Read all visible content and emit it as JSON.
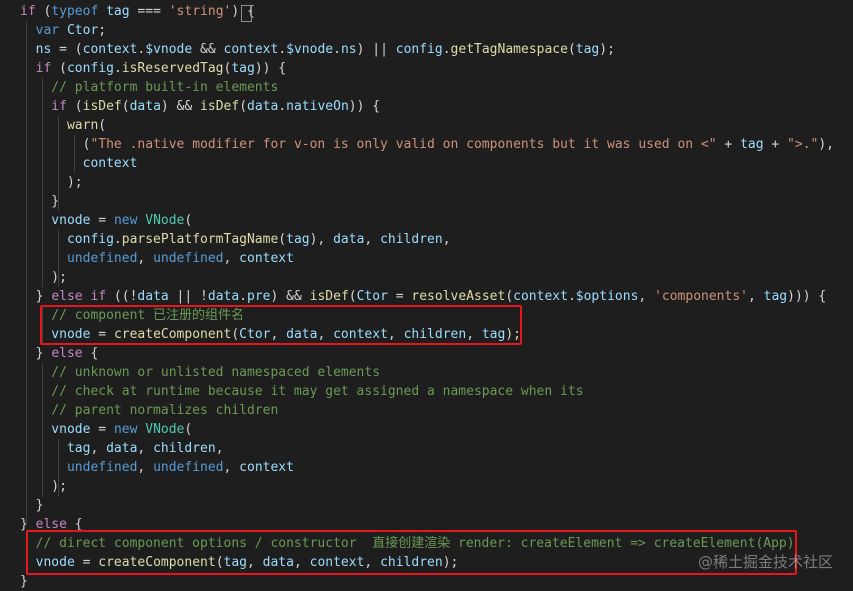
{
  "editor": {
    "theme": "dark",
    "background": "#1e1e1e",
    "colors": {
      "keyword": "#c586c0",
      "storage": "#569cd6",
      "function": "#dcdcaa",
      "variable": "#9cdcfe",
      "string": "#ce9178",
      "comment": "#6a9955",
      "plain": "#d4d4d4",
      "class": "#4ec9b0",
      "highlight_box": "#e4181c"
    },
    "lines": [
      [
        [
          "kw",
          "if"
        ],
        [
          "plain",
          " ("
        ],
        [
          "stor",
          "typeof"
        ],
        [
          "var",
          " tag"
        ],
        [
          "plain",
          " === "
        ],
        [
          "str",
          "'string'"
        ],
        [
          "plain",
          ") {"
        ]
      ],
      [
        [
          "stor",
          "  var"
        ],
        [
          "var",
          " Ctor"
        ],
        [
          "plain",
          ";"
        ]
      ],
      [
        [
          "var",
          "  ns"
        ],
        [
          "plain",
          " = ("
        ],
        [
          "var",
          "context"
        ],
        [
          "plain",
          "."
        ],
        [
          "var",
          "$vnode"
        ],
        [
          "plain",
          " && "
        ],
        [
          "var",
          "context"
        ],
        [
          "plain",
          "."
        ],
        [
          "var",
          "$vnode"
        ],
        [
          "plain",
          "."
        ],
        [
          "var",
          "ns"
        ],
        [
          "plain",
          ") || "
        ],
        [
          "var",
          "config"
        ],
        [
          "plain",
          "."
        ],
        [
          "fn",
          "getTagNamespace"
        ],
        [
          "plain",
          "("
        ],
        [
          "var",
          "tag"
        ],
        [
          "plain",
          ");"
        ]
      ],
      [
        [
          "kw",
          "  if"
        ],
        [
          "plain",
          " ("
        ],
        [
          "var",
          "config"
        ],
        [
          "plain",
          "."
        ],
        [
          "fn",
          "isReservedTag"
        ],
        [
          "plain",
          "("
        ],
        [
          "var",
          "tag"
        ],
        [
          "plain",
          ")) {"
        ]
      ],
      [
        [
          "cmt",
          "    // platform built-in elements"
        ]
      ],
      [
        [
          "kw",
          "    if"
        ],
        [
          "plain",
          " ("
        ],
        [
          "fn",
          "isDef"
        ],
        [
          "plain",
          "("
        ],
        [
          "var",
          "data"
        ],
        [
          "plain",
          ") && "
        ],
        [
          "fn",
          "isDef"
        ],
        [
          "plain",
          "("
        ],
        [
          "var",
          "data"
        ],
        [
          "plain",
          "."
        ],
        [
          "var",
          "nativeOn"
        ],
        [
          "plain",
          ")) {"
        ]
      ],
      [
        [
          "fn",
          "      warn"
        ],
        [
          "plain",
          "("
        ]
      ],
      [
        [
          "plain",
          "        ("
        ],
        [
          "str",
          "\"The .native modifier for v-on is only valid on components but it was used on <\""
        ],
        [
          "plain",
          " + "
        ],
        [
          "var",
          "tag"
        ],
        [
          "plain",
          " + "
        ],
        [
          "str",
          "\">.\""
        ],
        [
          "plain",
          "),"
        ]
      ],
      [
        [
          "var",
          "        context"
        ]
      ],
      [
        [
          "plain",
          "      );"
        ]
      ],
      [
        [
          "plain",
          "    }"
        ]
      ],
      [
        [
          "var",
          "    vnode"
        ],
        [
          "plain",
          " = "
        ],
        [
          "stor",
          "new"
        ],
        [
          "cls",
          " VNode"
        ],
        [
          "plain",
          "("
        ]
      ],
      [
        [
          "var",
          "      config"
        ],
        [
          "plain",
          "."
        ],
        [
          "fn",
          "parsePlatformTagName"
        ],
        [
          "plain",
          "("
        ],
        [
          "var",
          "tag"
        ],
        [
          "plain",
          "), "
        ],
        [
          "var",
          "data"
        ],
        [
          "plain",
          ", "
        ],
        [
          "var",
          "children"
        ],
        [
          "plain",
          ","
        ]
      ],
      [
        [
          "stor",
          "      undefined"
        ],
        [
          "plain",
          ", "
        ],
        [
          "stor",
          "undefined"
        ],
        [
          "plain",
          ", "
        ],
        [
          "var",
          "context"
        ]
      ],
      [
        [
          "plain",
          "    );"
        ]
      ],
      [
        [
          "plain",
          "  } "
        ],
        [
          "kw",
          "else if"
        ],
        [
          "plain",
          " ((!"
        ],
        [
          "var",
          "data"
        ],
        [
          "plain",
          " || !"
        ],
        [
          "var",
          "data"
        ],
        [
          "plain",
          "."
        ],
        [
          "var",
          "pre"
        ],
        [
          "plain",
          ") && "
        ],
        [
          "fn",
          "isDef"
        ],
        [
          "plain",
          "("
        ],
        [
          "var",
          "Ctor"
        ],
        [
          "plain",
          " = "
        ],
        [
          "fn",
          "resolveAsset"
        ],
        [
          "plain",
          "("
        ],
        [
          "var",
          "context"
        ],
        [
          "plain",
          "."
        ],
        [
          "var",
          "$options"
        ],
        [
          "plain",
          ", "
        ],
        [
          "str",
          "'components'"
        ],
        [
          "plain",
          ", "
        ],
        [
          "var",
          "tag"
        ],
        [
          "plain",
          "))) {"
        ]
      ],
      [
        [
          "cmt",
          "    // component 已注册的组件名"
        ]
      ],
      [
        [
          "var",
          "    vnode"
        ],
        [
          "plain",
          " = "
        ],
        [
          "fn",
          "createComponent"
        ],
        [
          "plain",
          "("
        ],
        [
          "var",
          "Ctor"
        ],
        [
          "plain",
          ", "
        ],
        [
          "var",
          "data"
        ],
        [
          "plain",
          ", "
        ],
        [
          "var",
          "context"
        ],
        [
          "plain",
          ", "
        ],
        [
          "var",
          "children"
        ],
        [
          "plain",
          ", "
        ],
        [
          "var",
          "tag"
        ],
        [
          "plain",
          ");"
        ]
      ],
      [
        [
          "plain",
          "  } "
        ],
        [
          "kw",
          "else"
        ],
        [
          "plain",
          " {"
        ]
      ],
      [
        [
          "cmt",
          "    // unknown or unlisted namespaced elements"
        ]
      ],
      [
        [
          "cmt",
          "    // check at runtime because it may get assigned a namespace when its"
        ]
      ],
      [
        [
          "cmt",
          "    // parent normalizes children"
        ]
      ],
      [
        [
          "var",
          "    vnode"
        ],
        [
          "plain",
          " = "
        ],
        [
          "stor",
          "new"
        ],
        [
          "cls",
          " VNode"
        ],
        [
          "plain",
          "("
        ]
      ],
      [
        [
          "var",
          "      tag"
        ],
        [
          "plain",
          ", "
        ],
        [
          "var",
          "data"
        ],
        [
          "plain",
          ", "
        ],
        [
          "var",
          "children"
        ],
        [
          "plain",
          ","
        ]
      ],
      [
        [
          "stor",
          "      undefined"
        ],
        [
          "plain",
          ", "
        ],
        [
          "stor",
          "undefined"
        ],
        [
          "plain",
          ", "
        ],
        [
          "var",
          "context"
        ]
      ],
      [
        [
          "plain",
          "    );"
        ]
      ],
      [
        [
          "plain",
          "  }"
        ]
      ],
      [
        [
          "plain",
          "} "
        ],
        [
          "kw",
          "else"
        ],
        [
          "plain",
          " {"
        ]
      ],
      [
        [
          "cmt",
          "  // direct component options / constructor  直接创建渲染 render: createElement => createElement(App)"
        ]
      ],
      [
        [
          "var",
          "  vnode"
        ],
        [
          "plain",
          " = "
        ],
        [
          "fn",
          "createComponent"
        ],
        [
          "plain",
          "("
        ],
        [
          "var",
          "tag"
        ],
        [
          "plain",
          ", "
        ],
        [
          "var",
          "data"
        ],
        [
          "plain",
          ", "
        ],
        [
          "var",
          "context"
        ],
        [
          "plain",
          ", "
        ],
        [
          "var",
          "children"
        ],
        [
          "plain",
          ");"
        ]
      ],
      [
        [
          "plain",
          "}"
        ]
      ]
    ]
  },
  "watermark": "@稀土掘金技术社区"
}
